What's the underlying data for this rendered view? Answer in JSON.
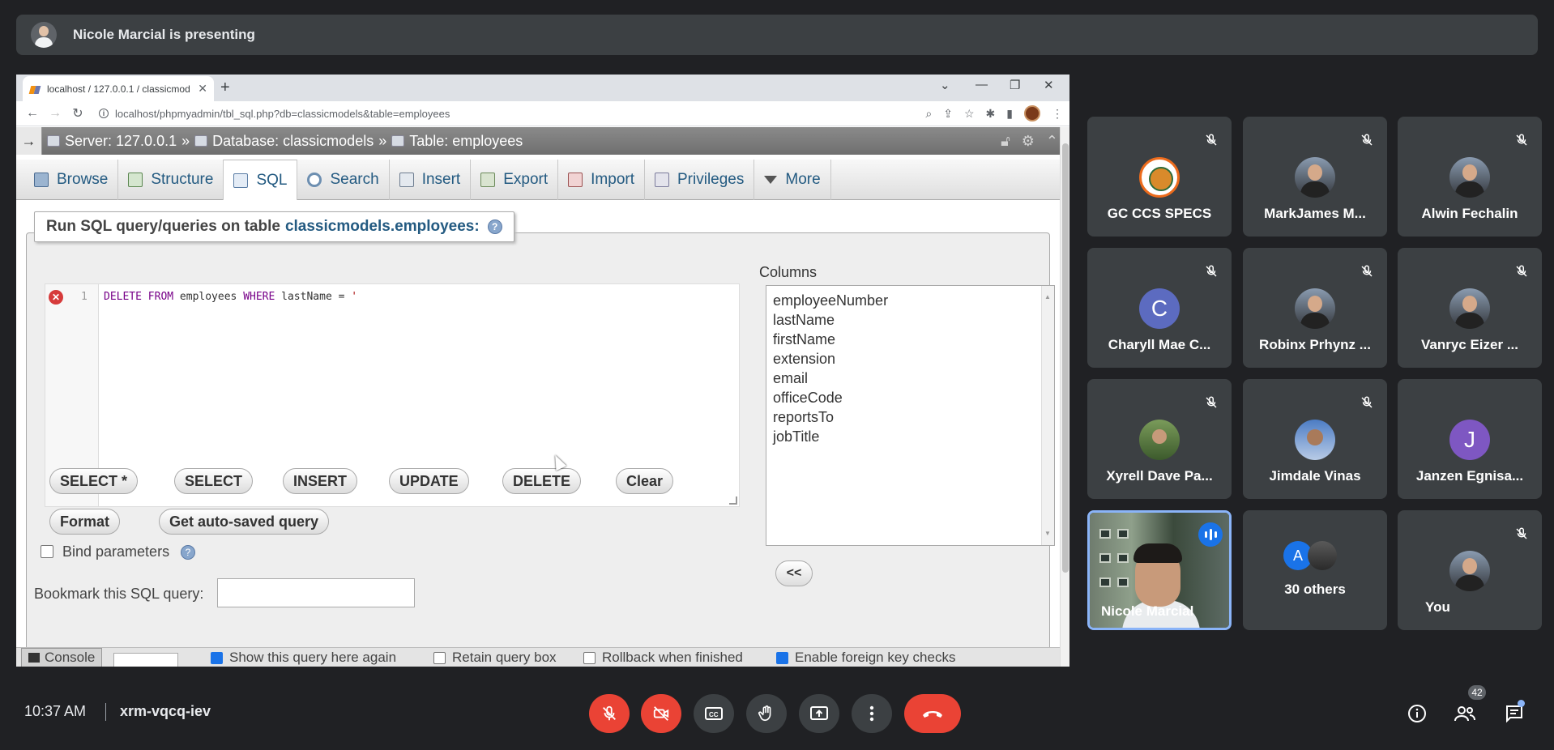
{
  "banner": {
    "text": "Nicole Marcial is presenting"
  },
  "browser": {
    "tab_title": "localhost / 127.0.0.1 / classicmod",
    "url": "localhost/phpmyadmin/tbl_sql.php?db=classicmodels&table=employees"
  },
  "pma": {
    "breadcrumb": {
      "server": "Server: 127.0.0.1",
      "sep1": "»",
      "database": "Database: classicmodels",
      "sep2": "»",
      "table": "Table: employees"
    },
    "tabs": [
      "Browse",
      "Structure",
      "SQL",
      "Search",
      "Insert",
      "Export",
      "Import",
      "Privileges",
      "More"
    ],
    "active_tab": "SQL",
    "legend_prefix": "Run SQL query/queries on table",
    "legend_table": "classicmodels.employees:",
    "editor": {
      "line_number": "1",
      "kw1": "DELETE FROM",
      "mid": " employees ",
      "kw2": "WHERE",
      "tail": " lastName = ",
      "str": "'"
    },
    "columns_label": "Columns",
    "columns": [
      "employeeNumber",
      "lastName",
      "firstName",
      "extension",
      "email",
      "officeCode",
      "reportsTo",
      "jobTitle"
    ],
    "insert_button": "<<",
    "buttons": [
      "SELECT *",
      "SELECT",
      "INSERT",
      "UPDATE",
      "DELETE",
      "Clear"
    ],
    "format_button": "Format",
    "autosaved_button": "Get auto-saved query",
    "bind_parameters": "Bind parameters",
    "bookmark_label": "Bookmark this SQL query:",
    "console": "Console",
    "options": {
      "show_query": "Show this query here again",
      "retain": "Retain query box",
      "rollback": "Rollback when finished",
      "foreign": "Enable foreign key checks"
    }
  },
  "participants": [
    {
      "name": "GC CCS SPECS"
    },
    {
      "name": "MarkJames M..."
    },
    {
      "name": "Alwin Fechalin"
    },
    {
      "name": "Charyll Mae C...",
      "initial": "C",
      "color": "#5c6bc0"
    },
    {
      "name": "Robinx Prhynz ..."
    },
    {
      "name": "Vanryc Eizer ..."
    },
    {
      "name": "Xyrell Dave Pa..."
    },
    {
      "name": "Jimdale Vinas"
    },
    {
      "name": "Janzen Egnisa...",
      "initial": "J",
      "color": "#7e57c2"
    },
    {
      "name": "Nicole Marcial"
    },
    {
      "name": "30 others",
      "initial": "A",
      "color": "#1a73e8"
    },
    {
      "name": "You"
    }
  ],
  "footer": {
    "time": "10:37 AM",
    "meeting_code": "xrm-vqcq-iev",
    "people_count": "42"
  },
  "colors": {
    "end_call": "#ea4335",
    "accent": "#8ab4f8",
    "pma_link": "#235a81"
  }
}
